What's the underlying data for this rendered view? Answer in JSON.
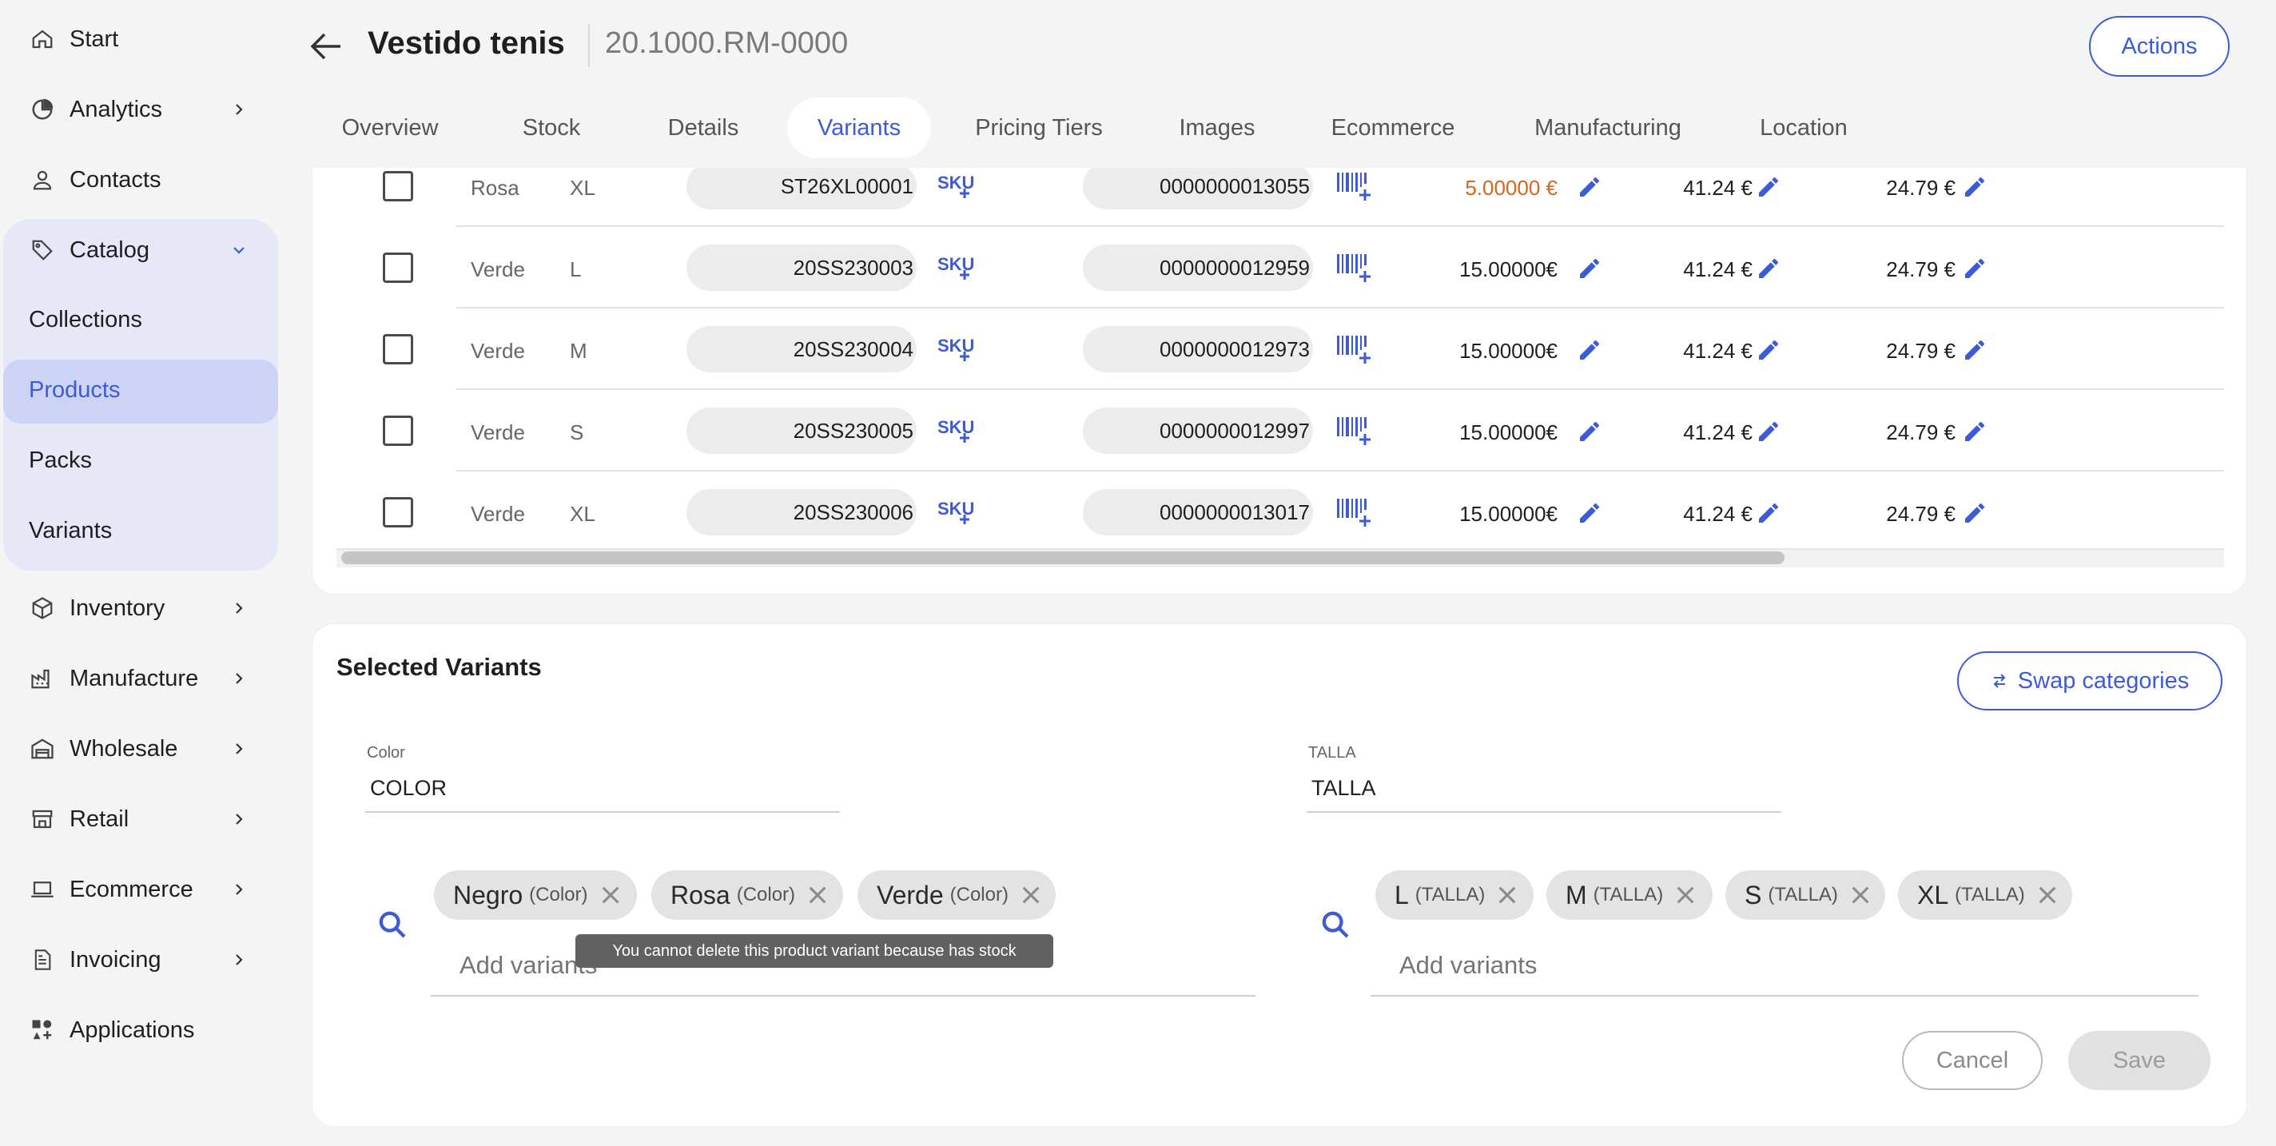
{
  "sidebar": {
    "start": "Start",
    "analytics": "Analytics",
    "contacts": "Contacts",
    "catalog": "Catalog",
    "collections": "Collections",
    "products": "Products",
    "packs": "Packs",
    "variants": "Variants",
    "inventory": "Inventory",
    "manufacture": "Manufacture",
    "wholesale": "Wholesale",
    "retail": "Retail",
    "ecommerce": "Ecommerce",
    "invoicing": "Invoicing",
    "applications": "Applications"
  },
  "header": {
    "title": "Vestido tenis",
    "sku": "20.1000.RM-0000",
    "actions_label": "Actions"
  },
  "tabs": [
    "Overview",
    "Stock",
    "Details",
    "Variants",
    "Pricing Tiers",
    "Images",
    "Ecommerce",
    "Manufacturing",
    "Location"
  ],
  "active_tab": "Variants",
  "rows": [
    {
      "color": "Rosa",
      "size": "XL",
      "sku": "ST26XL00001",
      "barcode": "0000000013055",
      "price": "5.00000 €",
      "cost": "41.24 €",
      "retail": "24.79 €",
      "highlight": true
    },
    {
      "color": "Verde",
      "size": "L",
      "sku": "20SS230003",
      "barcode": "0000000012959",
      "price": "15.00000€",
      "cost": "41.24 €",
      "retail": "24.79 €",
      "highlight": false
    },
    {
      "color": "Verde",
      "size": "M",
      "sku": "20SS230004",
      "barcode": "0000000012973",
      "price": "15.00000€",
      "cost": "41.24 €",
      "retail": "24.79 €",
      "highlight": false
    },
    {
      "color": "Verde",
      "size": "S",
      "sku": "20SS230005",
      "barcode": "0000000012997",
      "price": "15.00000€",
      "cost": "41.24 €",
      "retail": "24.79 €",
      "highlight": false
    },
    {
      "color": "Verde",
      "size": "XL",
      "sku": "20SS230006",
      "barcode": "0000000013017",
      "price": "15.00000€",
      "cost": "41.24 €",
      "retail": "24.79 €",
      "highlight": false
    }
  ],
  "selected": {
    "title": "Selected Variants",
    "swap_label": "Swap categories",
    "color_label": "Color",
    "color_value": "COLOR",
    "talla_label": "TALLA",
    "talla_value": "TALLA",
    "color_chips": [
      {
        "value": "Negro",
        "cat": "(Color)"
      },
      {
        "value": "Rosa",
        "cat": "(Color)"
      },
      {
        "value": "Verde",
        "cat": "(Color)"
      }
    ],
    "talla_chips": [
      {
        "value": "L",
        "cat": "(TALLA)"
      },
      {
        "value": "M",
        "cat": "(TALLA)"
      },
      {
        "value": "S",
        "cat": "(TALLA)"
      },
      {
        "value": "XL",
        "cat": "(TALLA)"
      }
    ],
    "add_placeholder": "Add variants",
    "tooltip": "You cannot delete this product variant because has stock",
    "cancel_label": "Cancel",
    "save_label": "Save"
  },
  "colors": {
    "accent": "#3d5bd6",
    "catalog_bg": "#e6e8f8",
    "active_item": "#cdd3f4",
    "warning_price": "#d6651e"
  }
}
